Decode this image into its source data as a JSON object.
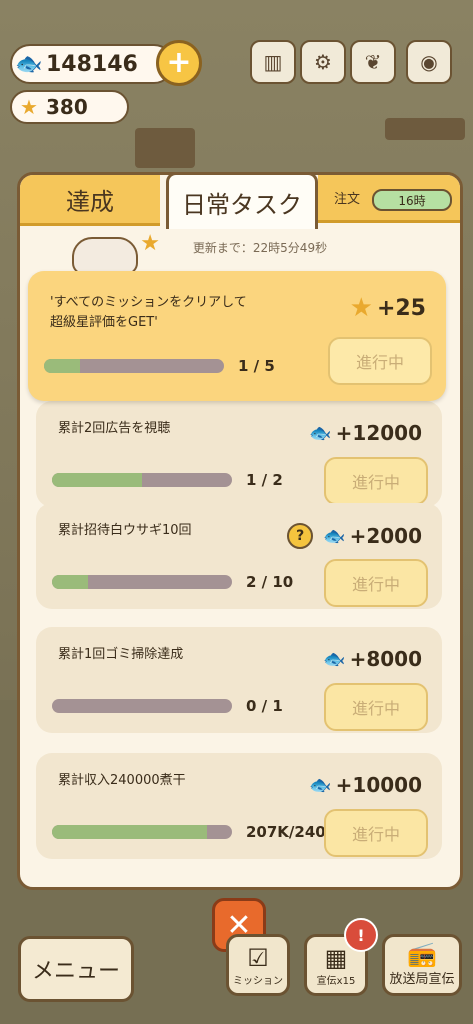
{
  "currency": {
    "fish": "148146",
    "stars": "380"
  },
  "tabs": {
    "achievements": "達成",
    "daily": "日常タスク",
    "order_label": "注文",
    "order_time": "16時"
  },
  "refresh_text": "更新まで：22時5分49秒",
  "tasks": [
    {
      "title": "'すべてのミッションをクリアして\n超級星評価をGET'",
      "reward": "+25",
      "reward_type": "star",
      "progress": "1 / 5",
      "fraction": 0.2,
      "button": "進行中"
    },
    {
      "title": "累計2回広告を視聴",
      "reward": "+12000",
      "reward_type": "fish",
      "progress": "1 / 2",
      "fraction": 0.5,
      "button": "進行中"
    },
    {
      "title": "累計招待白ウサギ10回",
      "reward": "+2000",
      "reward_type": "fish",
      "progress": "2 / 10",
      "fraction": 0.2,
      "button": "進行中",
      "help": "?"
    },
    {
      "title": "累計1回ゴミ掃除達成",
      "reward": "+8000",
      "reward_type": "fish",
      "progress": "0 / 1",
      "fraction": 0.0,
      "button": "進行中"
    },
    {
      "title": "累計収入240000煮干",
      "reward": "+10000",
      "reward_type": "fish",
      "progress": "207K/240K",
      "fraction": 0.86,
      "button": "進行中"
    }
  ],
  "bottom": {
    "menu": "メニュー",
    "mission": "ミッション",
    "promo": "宣伝x15",
    "broadcast": "放送局宣伝",
    "close": "✕",
    "badge": "!"
  },
  "colors": {
    "panel_border": "#7a5b35",
    "highlight_card": "#fbd57e",
    "progress_fill": "#9abb7a",
    "close": "#e86a2c"
  }
}
